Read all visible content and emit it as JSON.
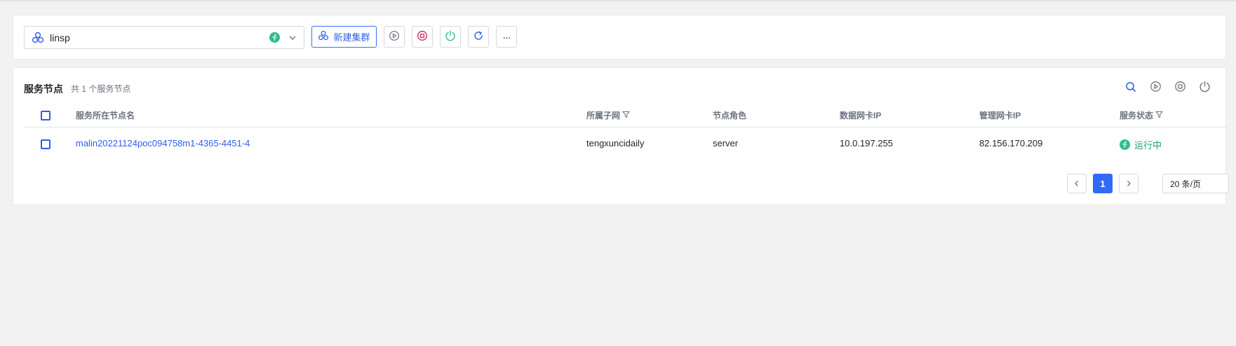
{
  "toolbar": {
    "cluster_name": "linsp",
    "new_cluster_label": "新建集群",
    "more_label": "···"
  },
  "section": {
    "title": "服务节点",
    "count_text": "共 1 个服务节点"
  },
  "table": {
    "columns": [
      "服务所在节点名",
      "所属子网",
      "节点角色",
      "数据网卡IP",
      "管理网卡IP",
      "服务状态"
    ],
    "rows": [
      {
        "node_name": "malin20221124poc094758m1-4365-4451-4",
        "subnet": "tengxuncidaily",
        "role": "server",
        "data_ip": "10.0.197.255",
        "mgmt_ip": "82.156.170.209",
        "status": "运行中"
      }
    ]
  },
  "pagination": {
    "current_page": "1",
    "page_size": "20 条/页"
  },
  "colors": {
    "accent": "#2f5ee8",
    "running": "#2bbf8a",
    "stop": "#d81b60",
    "power": "#2bbf8a"
  },
  "icons": [
    "cluster-icon",
    "running-icon",
    "chevron-down-icon",
    "play-icon",
    "stop-icon",
    "power-icon",
    "refresh-icon",
    "more-icon",
    "search-icon",
    "filter-icon",
    "chevron-left-icon",
    "chevron-right-icon"
  ]
}
